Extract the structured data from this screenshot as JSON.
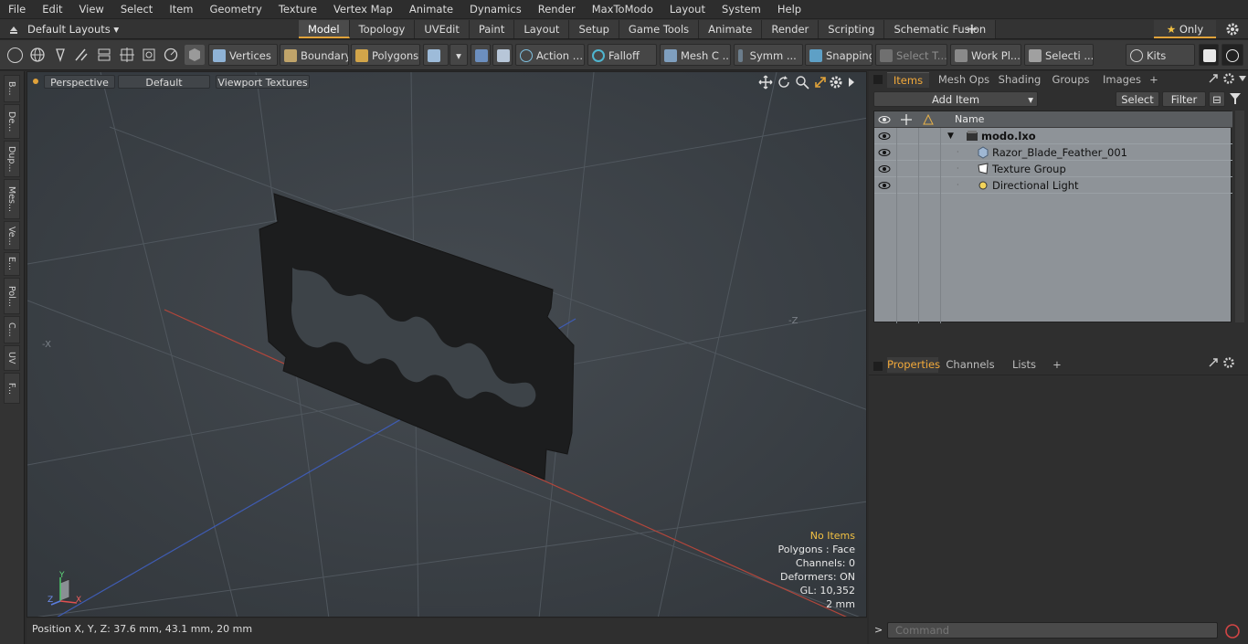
{
  "menubar": {
    "items": [
      "File",
      "Edit",
      "View",
      "Select",
      "Item",
      "Geometry",
      "Texture",
      "Vertex Map",
      "Animate",
      "Dynamics",
      "Render",
      "MaxToModo",
      "Layout",
      "System",
      "Help"
    ]
  },
  "modebar": {
    "layout_label": "Default Layouts",
    "tabs": [
      "Model",
      "Topology",
      "UVEdit",
      "Paint",
      "Layout",
      "Setup",
      "Game Tools",
      "Animate",
      "Render",
      "Scripting",
      "Schematic Fusion"
    ],
    "active_tab": "Model",
    "only_label": "Only"
  },
  "toolbar": {
    "vertices": "Vertices",
    "boundary": "Boundary",
    "polygons": "Polygons",
    "action": "Action",
    "falloff": "Falloff",
    "mesh": "Mesh C ...",
    "symm": "Symm ...",
    "snapping": "Snapping",
    "select_t": "Select T...",
    "work_pl": "Work Pl...",
    "selecti": "Selecti ...",
    "kits": "Kits"
  },
  "lefttabs": [
    "B...",
    "De...",
    "Dup...",
    "Mes...",
    "Ve...",
    "E...",
    "Pol...",
    "C...",
    "UV",
    "F..."
  ],
  "viewport": {
    "perspective": "Perspective",
    "default": "Default",
    "textures": "Viewport Textures",
    "stats": {
      "no_items": "No Items",
      "polygons": "Polygons : Face",
      "channels": "Channels: 0",
      "deformers": "Deformers: ON",
      "gl": "GL: 10,352",
      "unit": "2 mm"
    },
    "axis_y": "Y",
    "axis_z": "Z",
    "axis_x": "X",
    "neg_z": "-Z",
    "neg_x": "-X"
  },
  "status": {
    "position": "Position X, Y, Z:   37.6 mm, 43.1 mm, 20 mm"
  },
  "items_panel": {
    "tabs": [
      "Items",
      "Mesh Ops",
      "Shading",
      "Groups",
      "Images"
    ],
    "active_tab": "Items",
    "add_item": "Add Item",
    "select": "Select",
    "filter": "Filter",
    "column_name": "Name",
    "rows": [
      {
        "label": "modo.lxo",
        "icon": "scene-icon"
      },
      {
        "label": "Razor_Blade_Feather_001",
        "icon": "mesh-icon"
      },
      {
        "label": "Texture Group",
        "icon": "texture-group-icon"
      },
      {
        "label": "Directional Light",
        "icon": "light-icon"
      }
    ]
  },
  "props_panel": {
    "tabs": [
      "Properties",
      "Channels",
      "Lists"
    ],
    "active_tab": "Properties"
  },
  "command": {
    "placeholder": "Command",
    "prompt": ">"
  },
  "colors": {
    "accent": "#e0a23a",
    "viewport_bg": "#3a4046",
    "stats_highlight": "#f2c143"
  }
}
